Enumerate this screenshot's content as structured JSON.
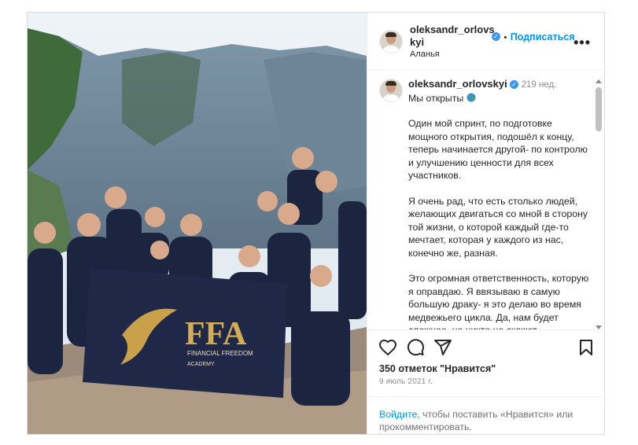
{
  "header": {
    "username": "oleksandr_orlovskyi",
    "username_line1": "oleksandr_orlovs",
    "username_line2": "kyi",
    "verified_mark": "✓",
    "separator": "•",
    "follow_label": "Подписаться",
    "location": "Аланья",
    "more_label": "•••"
  },
  "caption": {
    "username": "oleksandr_orlovskyi",
    "verified_mark": "✓",
    "age": "219 нед.",
    "first_line": "Мы открыты",
    "globe_icon": "globe-icon",
    "paragraphs": [
      "Один мой спринт, по подготовке мощного открытия, подошёл к концу, теперь начинается другой- по контролю и улучшению ценности для всех участников.",
      "Я очень рад, что есть столько людей, желающих двигаться со мной в сторону той жизни, о которой каждый где-то мечтает, которая у каждого из нас, конечно же, разная.",
      "Это огромная ответственность, которую я оправдаю. Я ввязываю в самую большую драку- я это делаю во время медвежьего цикла. Да, нам будет сложнее, но никто не скажет"
    ]
  },
  "photo": {
    "flag_logo": "FFA",
    "flag_line1": "FINANCIAL FREEDOM",
    "flag_line2": "ACADEMY"
  },
  "actions": {
    "icons": [
      "heart-icon",
      "comment-icon",
      "share-icon",
      "bookmark-icon"
    ],
    "likes": "350 отметок \"Нравится\"",
    "date": "9 июль 2021 г."
  },
  "login_prompt": {
    "link": "Войдите",
    "text": ", чтобы поставить «Нравится» или прокомментировать."
  },
  "colors": {
    "accent": "#0095f6",
    "verified": "#3897f0",
    "text": "#262626",
    "muted": "#8e8e8e"
  }
}
